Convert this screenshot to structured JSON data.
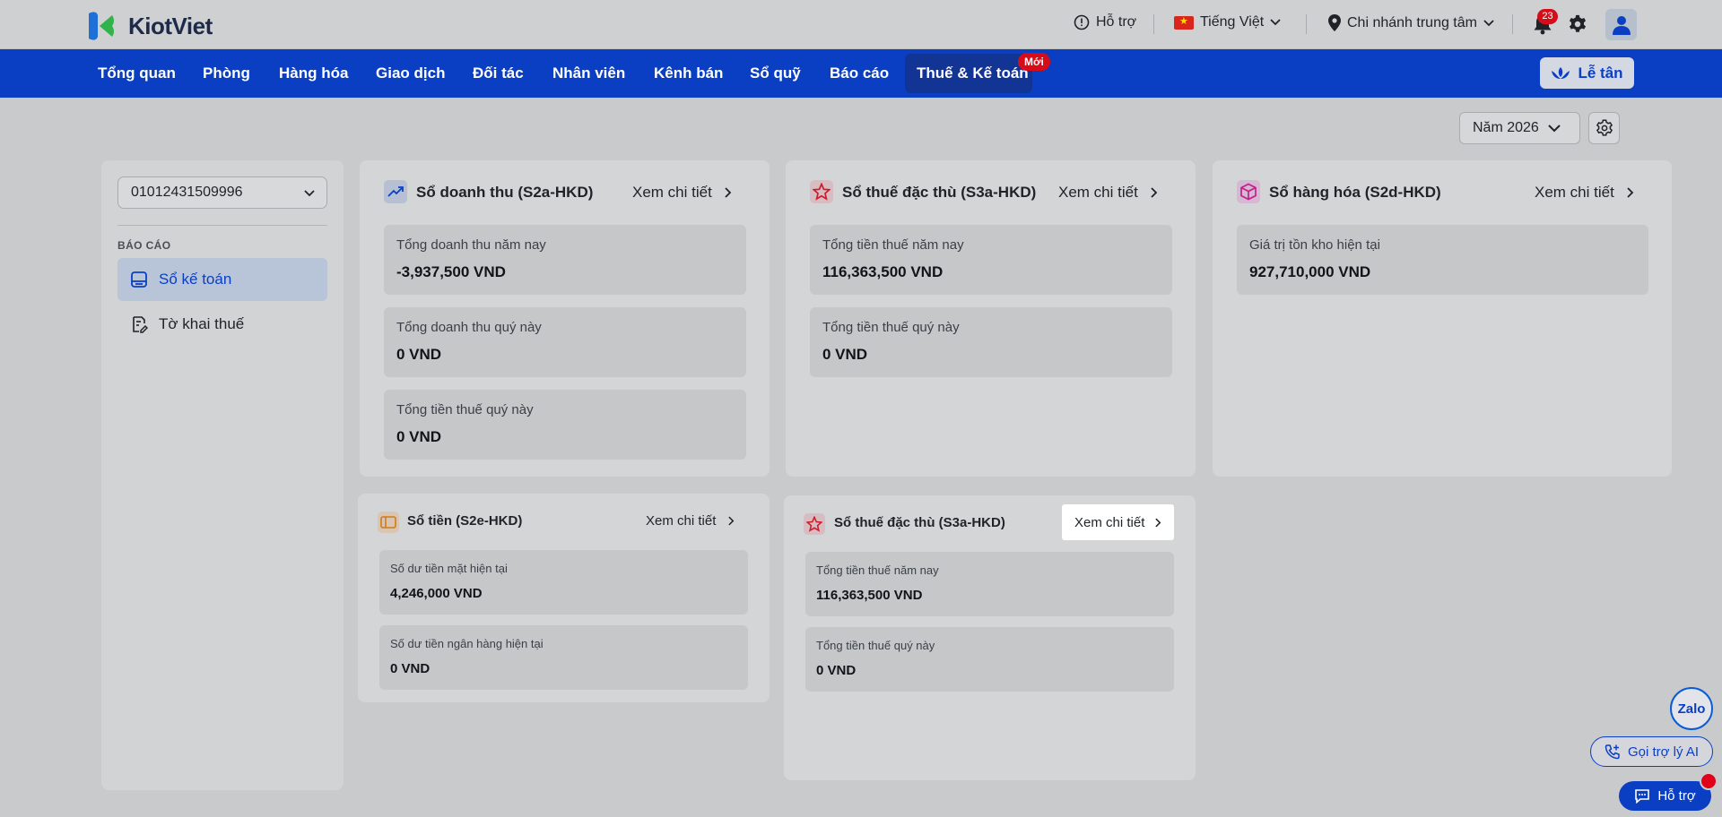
{
  "app": {
    "brand": "KiotViet"
  },
  "topbar": {
    "support": "Hỗ trợ",
    "language": "Tiếng Việt",
    "branch": "Chi nhánh trung tâm",
    "notification_count": "23"
  },
  "nav": {
    "items": [
      "Tổng quan",
      "Phòng",
      "Hàng hóa",
      "Giao dịch",
      "Đối tác",
      "Nhân viên",
      "Kênh bán",
      "Sổ quỹ",
      "Báo cáo",
      "Thuế & Kế toán"
    ],
    "active": "Thuế & Kế toán",
    "new_badge": "Mới",
    "reception_button": "Lễ tân"
  },
  "toolbar": {
    "year": "Năm 2026"
  },
  "sidebar": {
    "tax_code": "01012431509996",
    "section": "BÁO CÁO",
    "items": [
      {
        "label": "Sổ kế toán",
        "active": true
      },
      {
        "label": "Tờ khai thuế",
        "active": false
      }
    ]
  },
  "cards": {
    "revenue": {
      "title": "Sổ doanh thu (S2a-HKD)",
      "link": "Xem chi tiết",
      "stats": [
        {
          "label": "Tổng doanh thu năm nay",
          "value": "-3,937,500 VND"
        },
        {
          "label": "Tổng doanh thu quý này",
          "value": "0 VND"
        },
        {
          "label": "Tổng tiền thuế quý này",
          "value": "0 VND"
        }
      ]
    },
    "special_tax": {
      "title": "Sổ thuế đặc thù (S3a-HKD)",
      "link": "Xem chi tiết",
      "stats": [
        {
          "label": "Tổng tiền thuế năm nay",
          "value": "116,363,500 VND"
        },
        {
          "label": "Tổng tiền thuế quý này",
          "value": "0 VND"
        }
      ]
    },
    "goods": {
      "title": "Sổ hàng hóa (S2d-HKD)",
      "link": "Xem chi tiết",
      "stats": [
        {
          "label": "Giá trị tồn kho hiện tại",
          "value": "927,710,000 VND"
        }
      ]
    },
    "cash": {
      "title": "Sổ tiền (S2e-HKD)",
      "link": "Xem chi tiết",
      "stats": [
        {
          "label": "Số dư tiền mặt hiện tại",
          "value": "4,246,000 VND"
        },
        {
          "label": "Số dư tiền ngân hàng hiện tại",
          "value": "0 VND"
        }
      ]
    },
    "special_tax_2": {
      "title": "Sổ thuế đặc thù (S3a-HKD)",
      "link": "Xem chi tiết",
      "stats": [
        {
          "label": "Tổng tiền thuế năm nay",
          "value": "116,363,500 VND"
        },
        {
          "label": "Tổng tiền thuế quý này",
          "value": "0 VND"
        }
      ]
    }
  },
  "floating": {
    "zalo": "Zalo",
    "ai_call": "Gọi trợ lý AI",
    "support": "Hỗ trợ"
  },
  "colors": {
    "brand_blue": "#0a3fc4",
    "nav_active": "#123494",
    "badge_red": "#d70c19",
    "overlay_bg": "#c9cacc"
  }
}
